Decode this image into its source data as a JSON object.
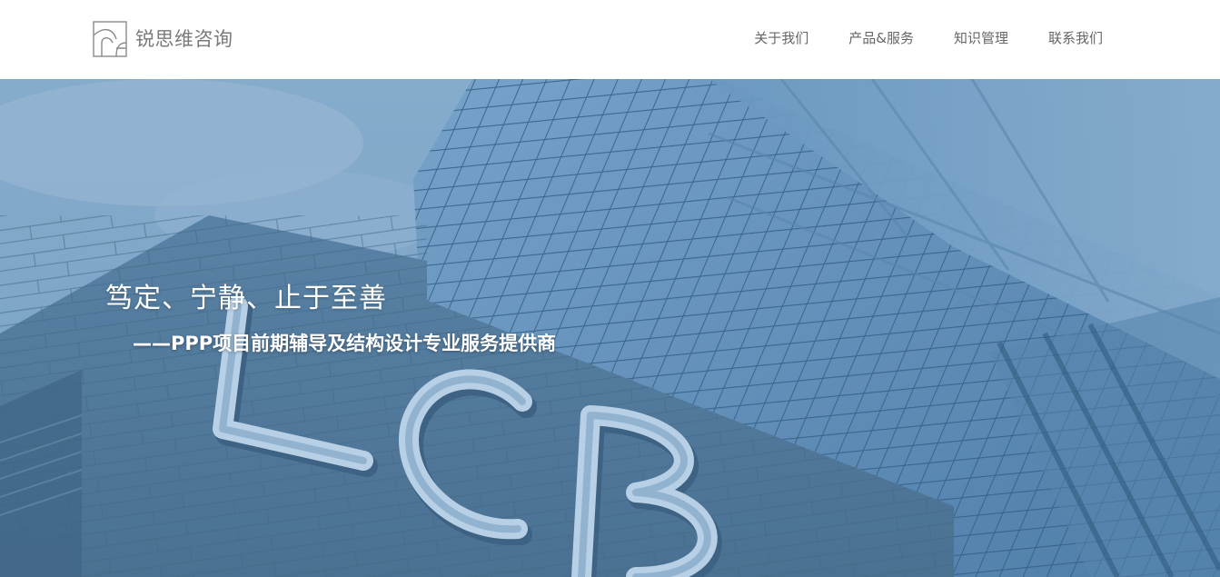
{
  "header": {
    "brand": "锐思维咨询",
    "logo_icon": "company-logo-icon"
  },
  "nav": {
    "items": [
      {
        "label": "关于我们"
      },
      {
        "label": "产品&服务"
      },
      {
        "label": "知识管理"
      },
      {
        "label": "联系我们"
      }
    ]
  },
  "hero": {
    "title": "笃定、宁静、止于至善",
    "subtitle": "——PPP项目前期辅导及结构设计专业服务提供商",
    "sign_letters": "LCB",
    "colors": {
      "sky": "#8fb3d2",
      "glass": "#5f8fb9",
      "building": "#4f7596",
      "nav_text": "#666666",
      "brand_text": "#7a7a7a"
    }
  }
}
